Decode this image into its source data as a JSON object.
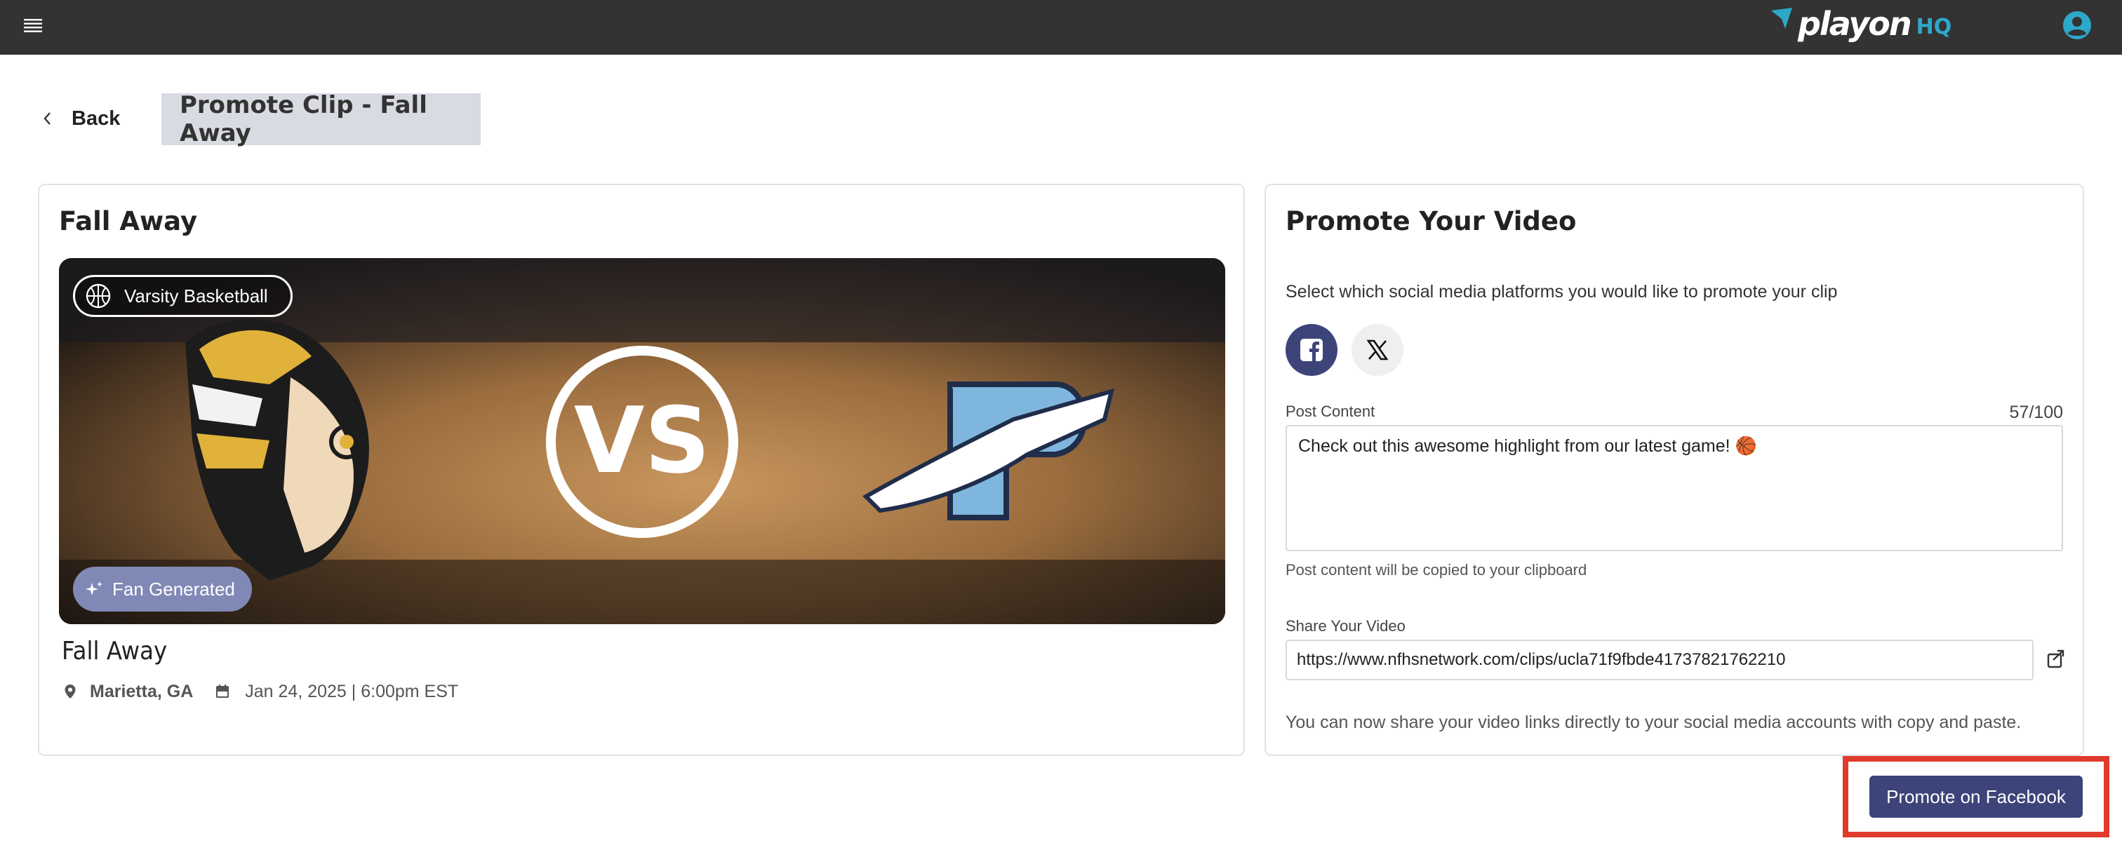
{
  "topbar": {
    "brand_name": "playon",
    "brand_suffix": "HQ",
    "icons": [
      "hamburger-menu-icon",
      "playon-arrow-icon",
      "user-account-icon"
    ]
  },
  "header": {
    "back_label": "Back",
    "page_title": "Promote Clip - Fall Away"
  },
  "clip": {
    "card_title": "Fall Away",
    "sport_badge": "Varsity Basketball",
    "fan_badge": "Fan Generated",
    "name": "Fall Away",
    "location": "Marietta, GA",
    "datetime": "Jan 24, 2025 | 6:00pm EST",
    "thumbnail_text": "VS",
    "icons": [
      "basketball-icon",
      "sparkle-icon",
      "location-pin-icon",
      "calendar-icon"
    ]
  },
  "promote": {
    "card_title": "Promote Your Video",
    "instruction": "Select which social media platforms you would like to promote your clip",
    "platforms": [
      {
        "name": "facebook",
        "selected": true
      },
      {
        "name": "x",
        "selected": false
      }
    ],
    "post_label": "Post Content",
    "post_counter": "57/100",
    "post_value": "Check out this awesome highlight from our latest game! 🏀",
    "post_helper": "Post content will be copied to your clipboard",
    "share_label": "Share Your Video",
    "share_url": "https://www.nfhsnetwork.com/clips/ucla71f9fbde41737821762210",
    "share_note": "You can now share your video links directly to your social media accounts with copy and paste."
  },
  "footer": {
    "promote_button": "Promote on Facebook"
  },
  "colors": {
    "topbar": "#333333",
    "accent": "#3c4479",
    "brand_hq": "#2ea8c9",
    "title_bg": "#d9dbe3",
    "fan_badge": "#8089b5",
    "highlight_border": "#e03a2b"
  }
}
